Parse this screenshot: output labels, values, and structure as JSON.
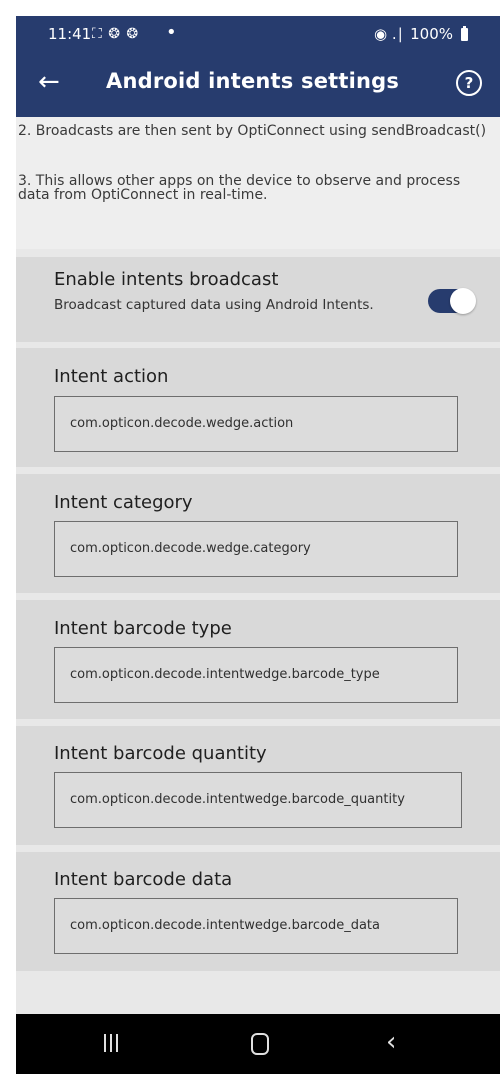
{
  "status_bar": {
    "time": "11:41",
    "left_icons": "⛶ ❂ ❂",
    "dot": "•",
    "signal": "◉ .∣",
    "battery_text": "100%"
  },
  "app_bar": {
    "title": "Android intents settings",
    "back_icon": "←",
    "help_icon": "?"
  },
  "intro": {
    "line2": "2. Broadcasts are then sent by OptiConnect using sendBroadcast()",
    "line3": "3. This allows other apps on the device to observe and process data from OptiConnect in real-time."
  },
  "broadcast_toggle": {
    "title": "Enable intents broadcast",
    "subtitle": "Broadcast captured data using Android Intents.",
    "enabled": true
  },
  "fields": [
    {
      "title": "Intent action",
      "value": "com.opticon.decode.wedge.action"
    },
    {
      "title": "Intent category",
      "value": "com.opticon.decode.wedge.category"
    },
    {
      "title": "Intent barcode type",
      "value": "com.opticon.decode.intentwedge.barcode_type"
    },
    {
      "title": "Intent barcode quantity",
      "value": "com.opticon.decode.intentwedge.barcode_quantity"
    },
    {
      "title": "Intent barcode data",
      "value": "com.opticon.decode.intentwedge.barcode_data"
    }
  ],
  "nav_bar": {
    "back_glyph": "‹"
  },
  "colors": {
    "primary": "#273c6e",
    "surface": "#d9d9d9",
    "background": "#e8e8e8"
  }
}
